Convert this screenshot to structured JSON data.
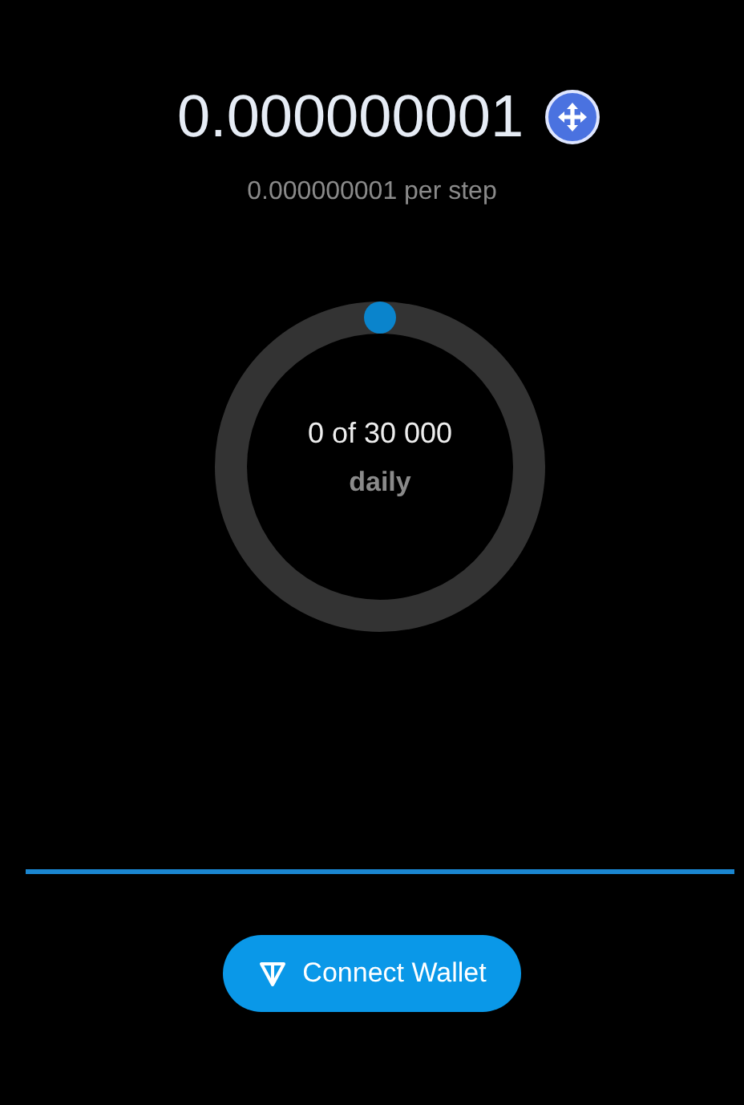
{
  "balance": {
    "amount": "0.000000001",
    "rate": "0.000000001 per step"
  },
  "progress": {
    "count": "0 of 30 000",
    "period": "daily"
  },
  "button": {
    "label": "Connect Wallet"
  }
}
